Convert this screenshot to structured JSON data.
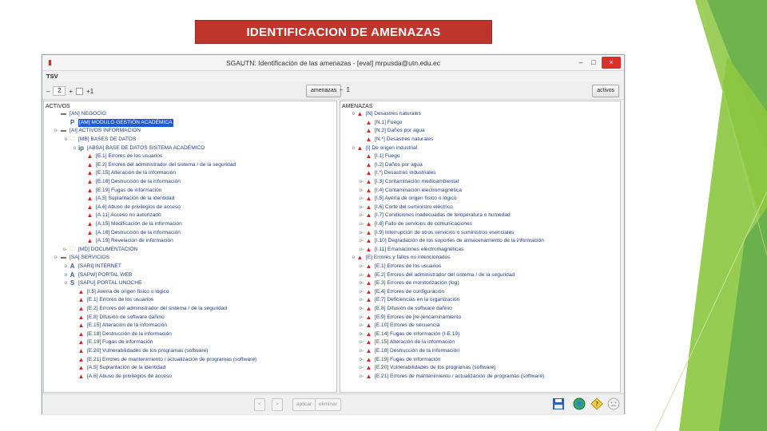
{
  "slide": {
    "title": "IDENTIFICACION DE AMENAZAS"
  },
  "window": {
    "title": "SGAUTN: Identificación de las amenazas - [eval] mrpusda@utn.edu.ec",
    "controls": {
      "minimize": "–",
      "maximize": "□",
      "close": "×"
    }
  },
  "menu": {
    "item": "TSV"
  },
  "toolbar": {
    "left_spinner": {
      "value": "2",
      "decrement": "–",
      "increment": "+"
    },
    "left_checkbox_label": "+1",
    "amenazas_button": "amenazas",
    "right_spinner": {
      "decrement": "–",
      "value": "1"
    },
    "activos_button": "activos"
  },
  "left_pane": {
    "title": "ACTIVOS",
    "rows": [
      {
        "pre": "",
        "ind": 0,
        "icon": "drive",
        "glyph": "▬",
        "text": "[AN] NEGOCIO"
      },
      {
        "pre": "",
        "ind": 1,
        "icon": "letter",
        "glyph": "P",
        "text": "[AM] MODULO GESTIÓN ACADÉMICA",
        "selected": true
      },
      {
        "pre": "o-",
        "ind": 0,
        "icon": "drive",
        "glyph": "▬",
        "text": "[AI] ACTIVOS INFORMACION"
      },
      {
        "pre": "o",
        "ind": 1,
        "icon": "folder",
        "glyph": "🗀",
        "text": "[MB] BASES DE DATOS"
      },
      {
        "pre": "o",
        "ind": 2,
        "icon": "letter",
        "glyph": "ip",
        "text": "[ABSA] BASE DE DATOS SISTEMA ACADÉMICO"
      },
      {
        "pre": "",
        "ind": 3,
        "icon": "warn",
        "glyph": "▲",
        "text": "[E.1] Errores de los usuarios"
      },
      {
        "pre": "",
        "ind": 3,
        "icon": "warn",
        "glyph": "▲",
        "text": "[E.2] Errores del administrador del sistema / de la seguridad"
      },
      {
        "pre": "",
        "ind": 3,
        "icon": "warn",
        "glyph": "▲",
        "text": "[E.15] Alteración de la información"
      },
      {
        "pre": "",
        "ind": 3,
        "icon": "warn",
        "glyph": "▲",
        "text": "[E.18] Destrucción de la información"
      },
      {
        "pre": "",
        "ind": 3,
        "icon": "warn",
        "glyph": "▲",
        "text": "[E.19] Fugas de información"
      },
      {
        "pre": "",
        "ind": 3,
        "icon": "warn",
        "glyph": "▲",
        "text": "[A.5] Suplantación de la identidad"
      },
      {
        "pre": "",
        "ind": 3,
        "icon": "warn",
        "glyph": "▲",
        "text": "[A.6] Abuso de privilegios de acceso"
      },
      {
        "pre": "",
        "ind": 3,
        "icon": "warn",
        "glyph": "▲",
        "text": "[A.11] Acceso no autorizado"
      },
      {
        "pre": "",
        "ind": 3,
        "icon": "warn",
        "glyph": "▲",
        "text": "[A.15] Modificación de la información"
      },
      {
        "pre": "",
        "ind": 3,
        "icon": "warn",
        "glyph": "▲",
        "text": "[A.18] Destrucción de la información"
      },
      {
        "pre": "",
        "ind": 3,
        "icon": "warn",
        "glyph": "▲",
        "text": "[A.19] Revelación de información"
      },
      {
        "pre": "o-",
        "ind": 1,
        "icon": "folder",
        "glyph": "🗀",
        "text": "[MD] DOCUMENTACIÓN"
      },
      {
        "pre": "o-",
        "ind": 0,
        "icon": "drive",
        "glyph": "▬",
        "text": "[SA] SERVICIOS"
      },
      {
        "pre": "o",
        "ind": 1,
        "icon": "letter",
        "glyph": "A",
        "text": "[SARI] INTERNET"
      },
      {
        "pre": "o",
        "ind": 1,
        "icon": "letter",
        "glyph": "A",
        "text": "[SAPW] PORTAL WEB"
      },
      {
        "pre": "o",
        "ind": 1,
        "icon": "letter",
        "glyph": "S",
        "text": "[SAPU] PORTAL UNOCHE"
      },
      {
        "pre": "",
        "ind": 2,
        "icon": "warn",
        "glyph": "▲",
        "text": "[I.5] Avería de origen físico o lógico"
      },
      {
        "pre": "",
        "ind": 2,
        "icon": "warn",
        "glyph": "▲",
        "text": "[E.1] Errores de los usuarios"
      },
      {
        "pre": "",
        "ind": 2,
        "icon": "warn",
        "glyph": "▲",
        "text": "[E.2] Errores del administrador del sistema / de la seguridad"
      },
      {
        "pre": "",
        "ind": 2,
        "icon": "warn",
        "glyph": "▲",
        "text": "[E.8] Difusión de software dañino"
      },
      {
        "pre": "",
        "ind": 2,
        "icon": "warn",
        "glyph": "▲",
        "text": "[E.15] Alteración de la información"
      },
      {
        "pre": "",
        "ind": 2,
        "icon": "warn",
        "glyph": "▲",
        "text": "[E.18] Destrucción de la información"
      },
      {
        "pre": "",
        "ind": 2,
        "icon": "warn",
        "glyph": "▲",
        "text": "[E.19] Fugas de información"
      },
      {
        "pre": "",
        "ind": 2,
        "icon": "warn",
        "glyph": "▲",
        "text": "[E.20] Vulnerabilidades de los programas (software)"
      },
      {
        "pre": "",
        "ind": 2,
        "icon": "warn",
        "glyph": "▲",
        "text": "[E.21] Errores de mantenimiento / actualización de programas (software)"
      },
      {
        "pre": "",
        "ind": 2,
        "icon": "warn",
        "glyph": "▲",
        "text": "[A.5] Suplantación de la identidad"
      },
      {
        "pre": "",
        "ind": 2,
        "icon": "warn",
        "glyph": "▲",
        "text": "[A.6] Abuso de privilegios de acceso"
      }
    ]
  },
  "right_pane": {
    "title": "AMENAZAS",
    "rows": [
      {
        "pre": "o",
        "ind": 0,
        "icon": "warn",
        "glyph": "▲",
        "text": "[N] Desastres naturales"
      },
      {
        "pre": "",
        "ind": 1,
        "icon": "warn",
        "glyph": "▲",
        "text": "[N.1] Fuego"
      },
      {
        "pre": "",
        "ind": 1,
        "icon": "warn",
        "glyph": "▲",
        "text": "[N.2] Daños por agua"
      },
      {
        "pre": "",
        "ind": 1,
        "icon": "warn",
        "glyph": "▲",
        "text": "[N.*] Desastres naturales"
      },
      {
        "pre": "o",
        "ind": 0,
        "icon": "warn",
        "glyph": "▲",
        "text": "[I] De origen industrial"
      },
      {
        "pre": "",
        "ind": 1,
        "icon": "warn",
        "glyph": "▲",
        "text": "[I.1] Fuego"
      },
      {
        "pre": "",
        "ind": 1,
        "icon": "warn",
        "glyph": "▲",
        "text": "[I.2] Daños por agua"
      },
      {
        "pre": "",
        "ind": 1,
        "icon": "warn",
        "glyph": "▲",
        "text": "[I.*] Desastres industriales"
      },
      {
        "pre": "o-",
        "ind": 1,
        "icon": "warn",
        "glyph": "▲",
        "text": "[I.3] Contaminación medioambiental"
      },
      {
        "pre": "o-",
        "ind": 1,
        "icon": "warn",
        "glyph": "▲",
        "text": "[I.4] Contaminación electromagnética"
      },
      {
        "pre": "o-",
        "ind": 1,
        "icon": "warn",
        "glyph": "▲",
        "text": "[I.5] Avería de origen físico o lógico"
      },
      {
        "pre": "o-",
        "ind": 1,
        "icon": "warn",
        "glyph": "▲",
        "text": "[I.6] Corte del suministro eléctrico"
      },
      {
        "pre": "o-",
        "ind": 1,
        "icon": "warn",
        "glyph": "▲",
        "text": "[I.7] Condiciones inadecuadas de temperatura o humedad"
      },
      {
        "pre": "o-",
        "ind": 1,
        "icon": "warn",
        "glyph": "▲",
        "text": "[I.8] Fallo de servicios de comunicaciones"
      },
      {
        "pre": "o-",
        "ind": 1,
        "icon": "warn",
        "glyph": "▲",
        "text": "[I.9] Interrupción de otros servicios o suministros esenciales"
      },
      {
        "pre": "o-",
        "ind": 1,
        "icon": "warn",
        "glyph": "▲",
        "text": "[I.10] Degradación de los soportes de almacenamiento de la información"
      },
      {
        "pre": "o-",
        "ind": 1,
        "icon": "warn",
        "glyph": "▲",
        "text": "[I.11] Emanaciones electromagnéticas"
      },
      {
        "pre": "o",
        "ind": 0,
        "icon": "warn",
        "glyph": "▲",
        "text": "[E] Errores y fallos no intencionados"
      },
      {
        "pre": "o-",
        "ind": 1,
        "icon": "warn",
        "glyph": "▲",
        "text": "[E.1] Errores de los usuarios"
      },
      {
        "pre": "o-",
        "ind": 1,
        "icon": "warn",
        "glyph": "▲",
        "text": "[E.2] Errores del administrador del sistema / de la seguridad"
      },
      {
        "pre": "o-",
        "ind": 1,
        "icon": "warn",
        "glyph": "▲",
        "text": "[E.3] Errores de monitorización (log)"
      },
      {
        "pre": "o-",
        "ind": 1,
        "icon": "warn",
        "glyph": "▲",
        "text": "[E.4] Errores de configuración"
      },
      {
        "pre": "o-",
        "ind": 1,
        "icon": "warn",
        "glyph": "▲",
        "text": "[E.7] Deficiencias en la organización"
      },
      {
        "pre": "o-",
        "ind": 1,
        "icon": "warn",
        "glyph": "▲",
        "text": "[E.8] Difusión de software dañino"
      },
      {
        "pre": "o-",
        "ind": 1,
        "icon": "warn",
        "glyph": "▲",
        "text": "[E.9] Errores de [re-]encaminamiento"
      },
      {
        "pre": "o-",
        "ind": 1,
        "icon": "warn",
        "glyph": "▲",
        "text": "[E.10] Errores de secuencia"
      },
      {
        "pre": "o-",
        "ind": 1,
        "icon": "warn",
        "glyph": "▲",
        "text": "[E.14] Fugas de información (I-E.19)"
      },
      {
        "pre": "o-",
        "ind": 1,
        "icon": "warn",
        "glyph": "▲",
        "text": "[E.15] Alteración de la información"
      },
      {
        "pre": "o-",
        "ind": 1,
        "icon": "warn",
        "glyph": "▲",
        "text": "[E.18] Destrucción de la información"
      },
      {
        "pre": "o-",
        "ind": 1,
        "icon": "warn",
        "glyph": "▲",
        "text": "[E.19] Fugas de información"
      },
      {
        "pre": "o-",
        "ind": 1,
        "icon": "warn",
        "glyph": "▲",
        "text": "[E.20] Vulnerabilidades de los programas (software)"
      },
      {
        "pre": "o-",
        "ind": 1,
        "icon": "warn",
        "glyph": "▲",
        "text": "[E.21] Errores de mantenimiento / actualización de programas (software)"
      }
    ]
  },
  "statusbar": {
    "prev": "<",
    "next": ">",
    "aplicar": "aplicar",
    "eliminar": "eliminar"
  },
  "colors": {
    "title_bg": "#c0352b",
    "selection": "#1b5bd3",
    "warning": "#d4231c",
    "tree_text": "#1f3f86"
  },
  "icons": {
    "save": "floppy-disk-icon",
    "help": "help-icon",
    "question": "question-icon",
    "status": "face-icon"
  }
}
